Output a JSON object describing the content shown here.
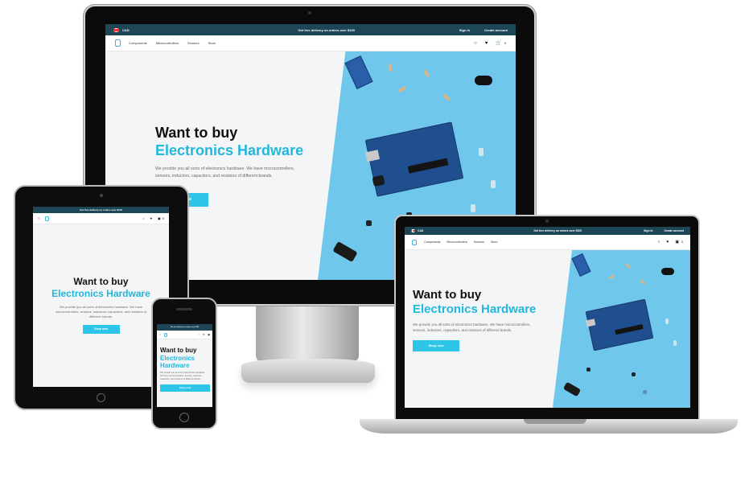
{
  "topbar": {
    "currency": "CAD",
    "promo": "Get free delivery on orders over $100",
    "sign_in": "Sign In",
    "create_account": "Create account"
  },
  "nav": {
    "links": [
      "Components",
      "Microcontrollers",
      "Sensors",
      "Store"
    ],
    "cart_count": "0"
  },
  "hero": {
    "line1": "Want to buy",
    "line2": "Electronics Hardware",
    "description": "We provide you all sorts of electronics hardware. We have microcontrollers, sensors, inductors, capacitors, and resistors of different brands.",
    "button": "Shop now"
  },
  "phone_hero": {
    "line2a": "Electronics",
    "line2b": "Hardware"
  },
  "colors": {
    "topbar_bg": "#1d4656",
    "accent": "#2ec6e8",
    "hero_image_bg": "#6fc8ec"
  },
  "icons": [
    "flag-canada-icon",
    "logo-icon",
    "search-icon",
    "heart-icon",
    "cart-icon",
    "menu-icon"
  ]
}
